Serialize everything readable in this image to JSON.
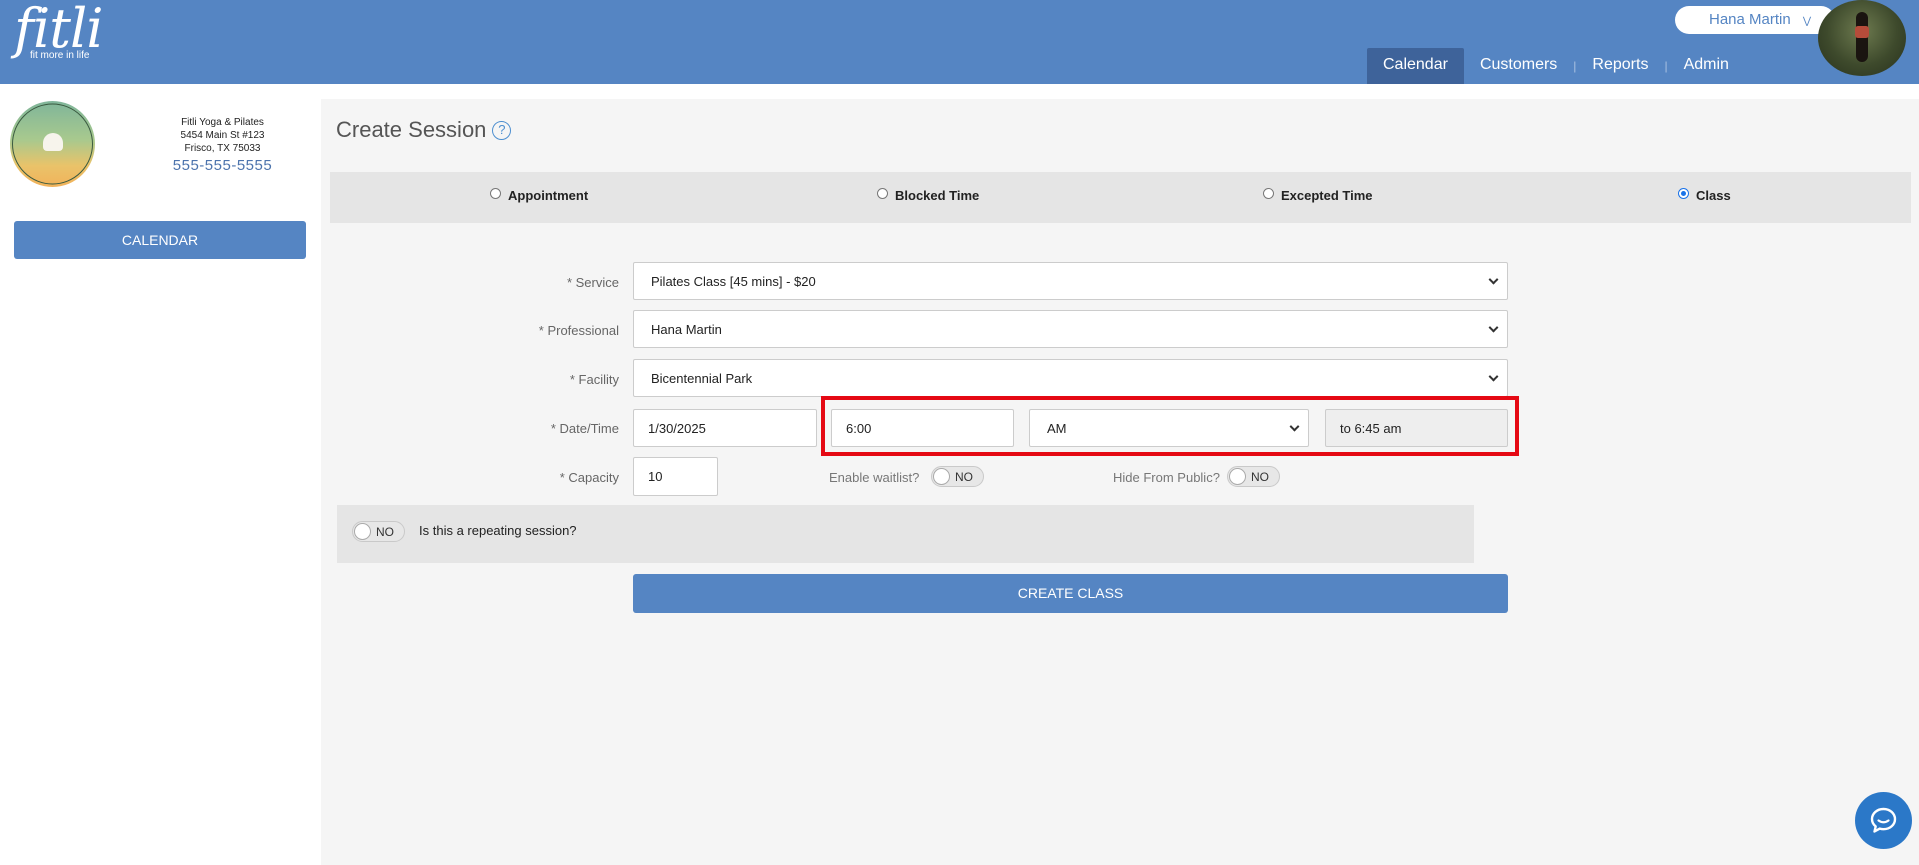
{
  "brand": {
    "logo_text": "fitli",
    "tagline": "fit more in life"
  },
  "header": {
    "user_name": "Hana Martin",
    "nav": [
      {
        "label": "Calendar",
        "active": true
      },
      {
        "label": "Customers",
        "active": false
      },
      {
        "label": "Reports",
        "active": false
      },
      {
        "label": "Admin",
        "active": false
      }
    ]
  },
  "sidebar": {
    "business_name": "Fitli Yoga & Pilates",
    "address_line1": "5454 Main St #123",
    "address_line2": "Frisco, TX 75033",
    "phone": "555-555-5555",
    "calendar_button": "CALENDAR"
  },
  "main": {
    "title": "Create Session",
    "session_types": [
      {
        "label": "Appointment",
        "selected": false
      },
      {
        "label": "Blocked Time",
        "selected": false
      },
      {
        "label": "Excepted Time",
        "selected": false
      },
      {
        "label": "Class",
        "selected": true
      }
    ],
    "form": {
      "service_label": "* Service",
      "service_value": "Pilates Class [45 mins] - $20",
      "professional_label": "* Professional",
      "professional_value": "Hana Martin",
      "facility_label": "* Facility",
      "facility_value": "Bicentennial Park",
      "datetime_label": "* Date/Time",
      "date_value": "1/30/2025",
      "time_value": "6:00",
      "ampm_value": "AM",
      "end_time_text": "to 6:45 am",
      "capacity_label": "* Capacity",
      "capacity_value": "10",
      "waitlist_label": "Enable waitlist?",
      "waitlist_state": "NO",
      "hide_label": "Hide From Public?",
      "hide_state": "NO",
      "repeat_state": "NO",
      "repeat_label": "Is this a repeating session?"
    },
    "create_button": "CREATE CLASS"
  },
  "colors": {
    "header_bg": "#5585c3",
    "nav_active": "#3e639a",
    "highlight": "#e50914"
  },
  "icons": {
    "help": "question-circle-icon",
    "chat": "chat-bubble-icon",
    "user_menu": "chevron-down-icon"
  }
}
